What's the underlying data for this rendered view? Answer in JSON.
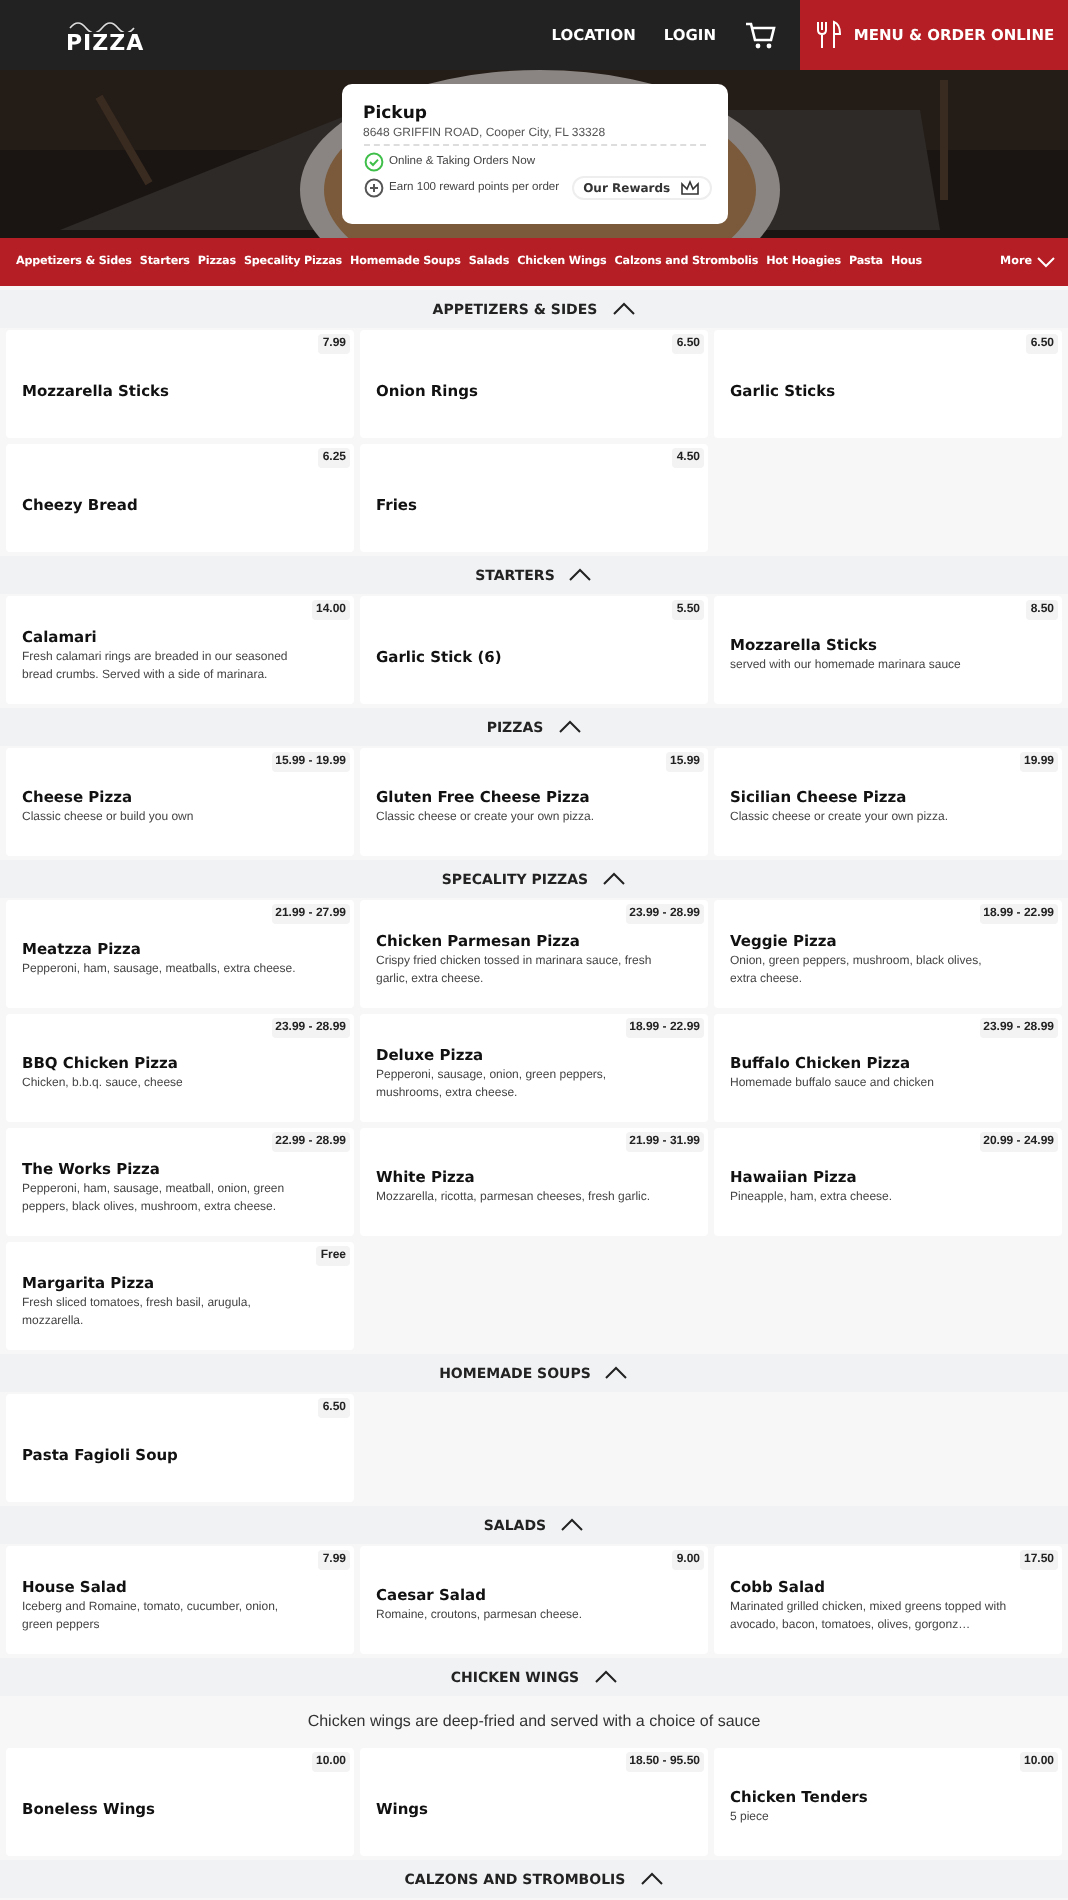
{
  "header": {
    "logo": "PIZZA",
    "links": [
      "LOCATION",
      "LOGIN"
    ],
    "order_button": "MENU & ORDER ONLINE"
  },
  "pickup": {
    "title": "Pickup",
    "address": "8648 GRIFFIN ROAD, Cooper City, FL 33328",
    "status": "Online & Taking Orders Now",
    "reward_text": "Earn 100 reward points per order",
    "rewards_button": "Our Rewards"
  },
  "category_tabs": [
    {
      "label": "Appetizers & Sides",
      "selected": false
    },
    {
      "label": "Starters",
      "selected": false
    },
    {
      "label": "Pizzas",
      "selected": false
    },
    {
      "label": "Specality Pizzas",
      "selected": false
    },
    {
      "label": "Homemade Soups",
      "selected": false
    },
    {
      "label": "Salads",
      "selected": false
    },
    {
      "label": "Chicken Wings",
      "selected": false
    },
    {
      "label": "Calzons and Strombolis",
      "selected": false
    },
    {
      "label": "Hot Hoagies",
      "selected": false
    },
    {
      "label": "Pasta",
      "selected": false
    },
    {
      "label": "Hous",
      "selected": false
    }
  ],
  "more_button": "More",
  "sections": [
    {
      "title": "APPETIZERS & SIDES",
      "expanded": true,
      "items": [
        {
          "name": "Mozzarella Sticks",
          "price": "7.99"
        },
        {
          "name": "Onion Rings",
          "price": "6.50"
        },
        {
          "name": "Garlic Sticks",
          "price": "6.50"
        },
        {
          "name": "Cheezy Bread",
          "price": "6.25"
        },
        {
          "name": "Fries",
          "price": "4.50"
        }
      ]
    },
    {
      "title": "STARTERS",
      "expanded": true,
      "items": [
        {
          "name": "Calamari",
          "price": "14.00",
          "description": "Fresh calamari rings are breaded in our seasoned bread crumbs. Served with a side of marinara."
        },
        {
          "name": "Garlic Stick (6)",
          "price": "5.50"
        },
        {
          "name": "Mozzarella Sticks",
          "price": "8.50",
          "description": "served with our homemade marinara sauce"
        }
      ]
    },
    {
      "title": "PIZZAS",
      "expanded": true,
      "items": [
        {
          "name": "Cheese Pizza",
          "price": "15.99 - 19.99",
          "description": "Classic cheese or build you own"
        },
        {
          "name": "Gluten Free Cheese Pizza",
          "price": "15.99",
          "description": "Classic cheese or create your own pizza."
        },
        {
          "name": "Sicilian Cheese Pizza",
          "price": "19.99",
          "description": "Classic cheese or create your own pizza."
        }
      ]
    },
    {
      "title": "SPECALITY PIZZAS",
      "expanded": true,
      "items": [
        {
          "name": "Meatzza Pizza",
          "price": "21.99 - 27.99",
          "description": "Pepperoni, ham, sausage, meatballs, extra cheese."
        },
        {
          "name": "Chicken Parmesan Pizza",
          "price": "23.99 - 28.99",
          "description": "Crispy fried chicken tossed in marinara sauce, fresh garlic, extra cheese."
        },
        {
          "name": "Veggie Pizza",
          "price": "18.99 - 22.99",
          "description": "Onion, green peppers, mushroom, black olives, extra cheese."
        },
        {
          "name": "BBQ Chicken Pizza",
          "price": "23.99 - 28.99",
          "description": "Chicken, b.b.q. sauce, cheese"
        },
        {
          "name": "Deluxe Pizza",
          "price": "18.99 - 22.99",
          "description": "Pepperoni, sausage, onion, green peppers, mushrooms, extra cheese."
        },
        {
          "name": "Buffalo Chicken Pizza",
          "price": "23.99 - 28.99",
          "description": "Homemade buffalo sauce and chicken"
        },
        {
          "name": "The Works Pizza",
          "price": "22.99 - 28.99",
          "description": "Pepperoni, ham, sausage, meatball, onion, green peppers, black olives, mushroom, extra cheese."
        },
        {
          "name": "White Pizza",
          "price": "21.99 - 31.99",
          "description": "Mozzarella, ricotta, parmesan cheeses, fresh garlic."
        },
        {
          "name": "Hawaiian Pizza",
          "price": "20.99 - 24.99",
          "description": "Pineapple, ham, extra cheese."
        },
        {
          "name": "Margarita Pizza",
          "price": "Free",
          "description": "Fresh sliced tomatoes, fresh basil, arugula, mozzarella."
        }
      ]
    },
    {
      "title": "HOMEMADE SOUPS",
      "expanded": true,
      "items": [
        {
          "name": "Pasta Fagioli Soup",
          "price": "6.50"
        }
      ]
    },
    {
      "title": "SALADS",
      "expanded": true,
      "items": [
        {
          "name": "House Salad",
          "price": "7.99",
          "description": "Iceberg and Romaine, tomato, cucumber, onion, green peppers"
        },
        {
          "name": "Caesar Salad",
          "price": "9.00",
          "description": "Romaine, croutons, parmesan cheese."
        },
        {
          "name": "Cobb Salad",
          "price": "17.50",
          "description": "Marinated grilled chicken, mixed greens topped with avocado, bacon, tomatoes, olives, gorgonz…"
        }
      ]
    },
    {
      "title": "CHICKEN WINGS",
      "expanded": true,
      "description": "Chicken wings are deep-fried and served with a choice of sauce",
      "items": [
        {
          "name": "Boneless Wings",
          "price": "10.00"
        },
        {
          "name": "Wings",
          "price": "18.50 - 95.50"
        },
        {
          "name": "Chicken Tenders",
          "price": "10.00",
          "description": "5 piece"
        }
      ]
    },
    {
      "title": "CALZONS AND STROMBOLIS",
      "expanded": true
    }
  ]
}
